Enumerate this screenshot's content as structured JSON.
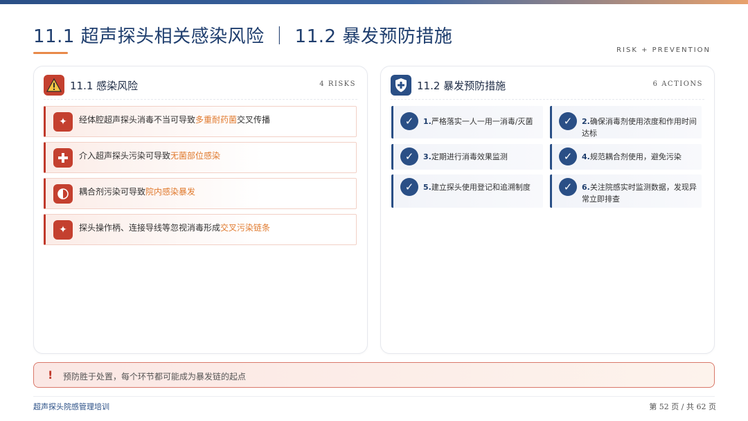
{
  "header": {
    "title": "11.1 超声探头相关感染风险 ｜ 11.2 暴发预防措施",
    "tag": "RISK + PREVENTION"
  },
  "risks_panel": {
    "title": "11.1 感染风险",
    "count": "4 RISKS",
    "icon": "warning-icon",
    "items": [
      {
        "icon": "sparkle-icon",
        "text_before": "经体腔超声探头消毒不当可导致",
        "highlight": "多重耐药菌",
        "text_after": "交叉传播"
      },
      {
        "icon": "plus-icon",
        "text_before": "介入超声探头污染可导致",
        "highlight": "无菌部位感染",
        "text_after": ""
      },
      {
        "icon": "half-circle-icon",
        "text_before": "耦合剂污染可导致",
        "highlight": "院内感染暴发",
        "text_after": ""
      },
      {
        "icon": "sparkle-icon",
        "text_before": "探头操作柄、连接导线等忽视消毒形成",
        "highlight": "交叉污染链条",
        "text_after": ""
      }
    ]
  },
  "actions_panel": {
    "title": "11.2 暴发预防措施",
    "count": "6 ACTIONS",
    "icon": "shield-plus-icon",
    "items": [
      {
        "num": "1.",
        "text": "严格落实一人一用一消毒/灭菌"
      },
      {
        "num": "2.",
        "text": "确保消毒剂使用浓度和作用时间达标"
      },
      {
        "num": "3.",
        "text": "定期进行消毒效果监测"
      },
      {
        "num": "4.",
        "text": "规范耦合剂使用，避免污染"
      },
      {
        "num": "5.",
        "text": "建立探头使用登记和追溯制度"
      },
      {
        "num": "6.",
        "text": "关注院感实时监测数据，发现异常立即排查"
      }
    ]
  },
  "alert": {
    "icon": "exclamation-icon",
    "text": "预防胜于处置，每个环节都可能成为暴发链的起点"
  },
  "footer": {
    "course": "超声探头院感管理培训",
    "page": "第 52 页 / 共 62 页"
  },
  "colors": {
    "primary": "#2a4f86",
    "danger": "#c4402f",
    "highlight": "#e07a2e"
  }
}
